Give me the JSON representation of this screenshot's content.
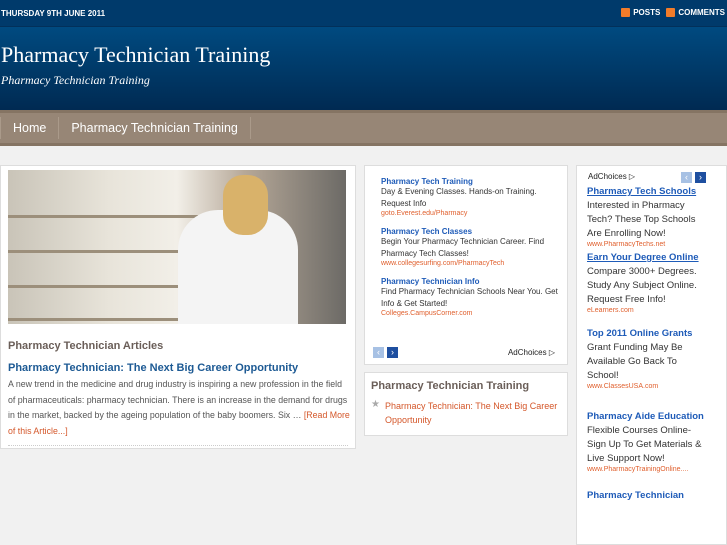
{
  "topbar": {
    "date": "THURSDAY 9TH JUNE 2011",
    "posts": "POSTS",
    "comments": "COMMENTS"
  },
  "header": {
    "title": "Pharmacy Technician Training",
    "tagline": "Pharmacy Technician Training"
  },
  "nav": [
    "Home",
    "Pharmacy Technician Training"
  ],
  "main": {
    "section_title": "Pharmacy Technician Articles",
    "post_title": "Pharmacy Technician: The Next Big Career Opportunity",
    "excerpt": "A new trend in the medicine and drug industry is inspiring a new profession in the field of pharmaceuticals: pharmacy technician. There is an increase in the demand for drugs in the market, backed by the ageing population of the baby boomers. Six … ",
    "read_more": "[Read More of this Article...]"
  },
  "ads_middle": [
    {
      "title": "Pharmacy Tech Training",
      "desc": "Day & Evening Classes. Hands-on Training. Request Info",
      "url": "goto.Everest.edu/Pharmacy"
    },
    {
      "title": "Pharmacy Tech Classes",
      "desc": "Begin Your Pharmacy Technician Career. Find Pharmacy Tech Classes!",
      "url": "www.collegesurfing.com/PharmacyTech"
    },
    {
      "title": "Pharmacy Technician Info",
      "desc": "Find Pharmacy Technician Schools Near You. Get Info & Get Started!",
      "url": "Colleges.CampusCorner.com"
    }
  ],
  "adchoices": "AdChoices",
  "widget": {
    "title": "Pharmacy Technician Training",
    "item": "Pharmacy Technician: The Next Big Career Opportunity"
  },
  "ads_right": [
    {
      "title": "Pharmacy Tech Schools",
      "desc": "Interested in Pharmacy Tech? These Top Schools Are Enrolling Now!",
      "url": "www.PharmacyTechs.net"
    },
    {
      "title": "Earn Your Degree Online",
      "desc": "Compare 3000+ Degrees. Study Any Subject Online. Request Free Info!",
      "url": "eLearners.com"
    },
    {
      "title": "Top 2011 Online Grants",
      "desc": "Grant Funding May Be Available Go Back To School!",
      "url": "www.ClassesUSA.com"
    },
    {
      "title": "Pharmacy Aide Education",
      "desc": "Flexible Courses Online- Sign Up To Get Materials & Live Support Now!",
      "url": "www.PharmacyTrainingOnline...."
    },
    {
      "title": "Pharmacy Technician",
      "desc": "",
      "url": ""
    }
  ]
}
